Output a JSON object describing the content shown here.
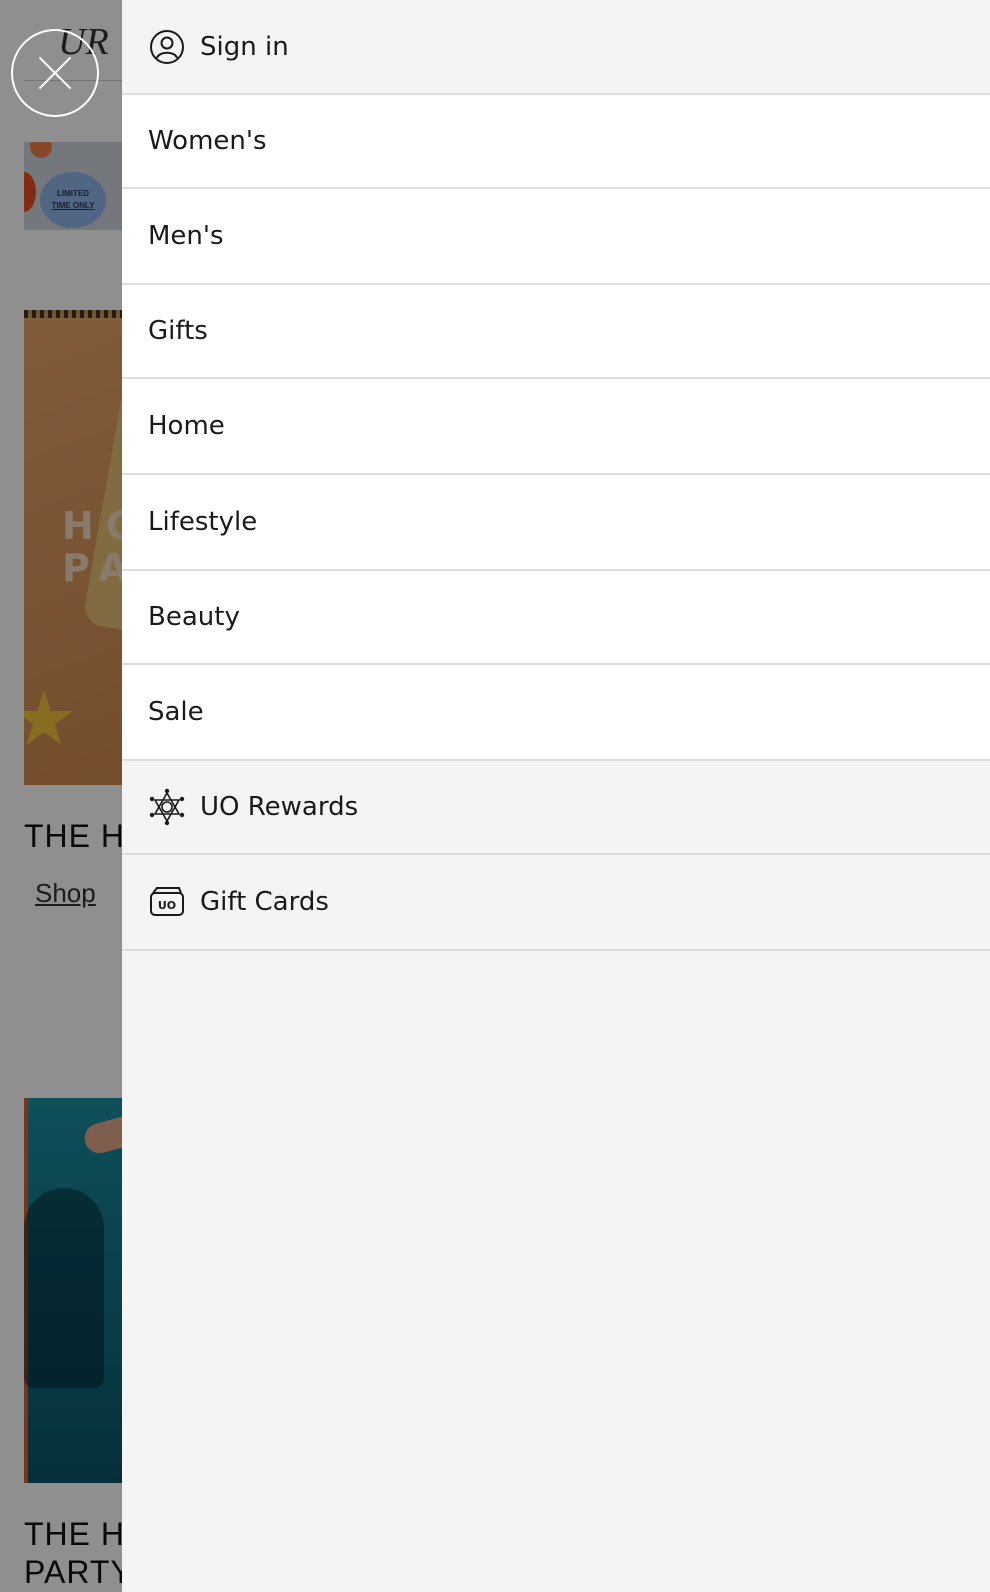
{
  "background": {
    "promo_badge_line1": "LIMITED",
    "promo_badge_line2": "TIME ONLY",
    "hero1_text_line1": "HO",
    "hero1_text_line2": "PA",
    "section1_title": "THE H",
    "section1_link": "Shop",
    "section2_title_line1": "THE H",
    "section2_title_line2": "PARTY"
  },
  "drawer": {
    "sign_in": {
      "label": "Sign in",
      "icon": "user-circle-icon"
    },
    "categories": [
      {
        "label": "Women's"
      },
      {
        "label": "Men's"
      },
      {
        "label": "Gifts"
      },
      {
        "label": "Home"
      },
      {
        "label": "Lifestyle"
      },
      {
        "label": "Beauty"
      },
      {
        "label": "Sale"
      }
    ],
    "extras": [
      {
        "label": "UO Rewards",
        "icon": "rewards-icon"
      },
      {
        "label": "Gift Cards",
        "icon": "gift-card-icon",
        "icon_text": "UO"
      }
    ]
  },
  "colors": {
    "drawer_bg": "#f4f4f4",
    "item_bg": "#ffffff",
    "divider": "#dedede",
    "text": "#1a1a1a"
  }
}
